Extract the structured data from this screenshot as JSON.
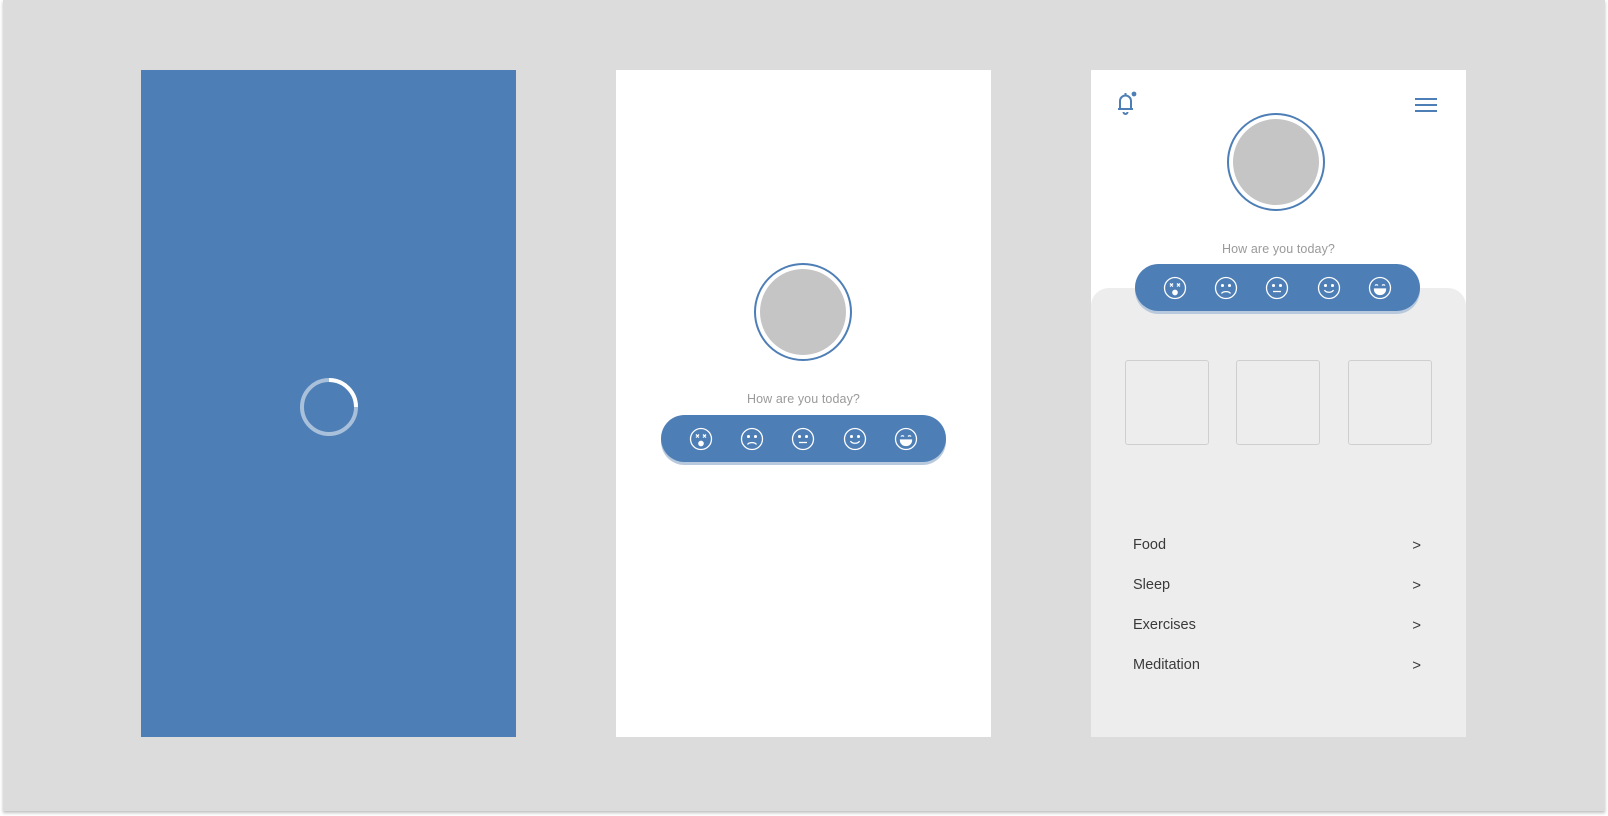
{
  "colors": {
    "canvas": "#dcdcdc",
    "brand_blue": "#4d7eb6",
    "avatar_fill": "#c5c5c5",
    "panel_bg": "#ededed",
    "muted_text": "#9a9a9a"
  },
  "splash": {
    "spinner_icon": "loading-spinner-icon"
  },
  "onboarding": {
    "question": "How are you today?",
    "moods": [
      "dizzy-face-icon",
      "sad-face-icon",
      "neutral-face-icon",
      "smile-face-icon",
      "grin-face-icon"
    ]
  },
  "home": {
    "header": {
      "notification_icon": "bell-icon",
      "menu_icon": "hamburger-menu-icon"
    },
    "question": "How are you today?",
    "moods": [
      "dizzy-face-icon",
      "sad-face-icon",
      "neutral-face-icon",
      "smile-face-icon",
      "grin-face-icon"
    ],
    "cards": [
      "",
      "",
      ""
    ],
    "nav_items": [
      {
        "label": "Food",
        "chevron": ">"
      },
      {
        "label": "Sleep",
        "chevron": ">"
      },
      {
        "label": "Exercises",
        "chevron": ">"
      },
      {
        "label": "Meditation",
        "chevron": ">"
      }
    ]
  }
}
